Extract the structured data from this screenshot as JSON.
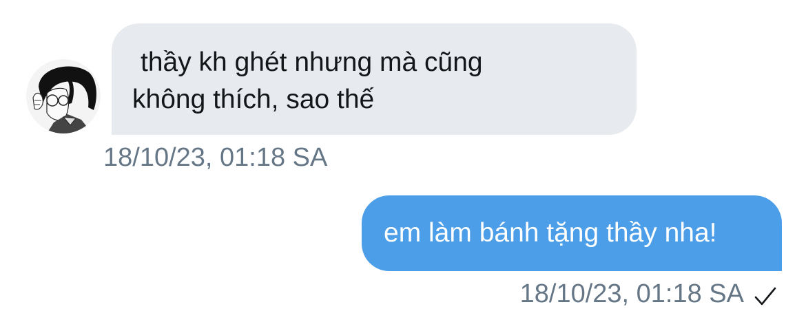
{
  "messages": [
    {
      "direction": "incoming",
      "lines": [
        "thầy kh ghét nhưng mà cũng",
        "không thích, sao thế"
      ],
      "timestamp": "18/10/23, 01:18 SA",
      "avatar_icon": "user-avatar-icon"
    },
    {
      "direction": "outgoing",
      "text": "em làm bánh tặng thầy nha!",
      "timestamp": "18/10/23, 01:18 SA",
      "status_icon": "checkmark-icon"
    }
  ],
  "colors": {
    "incoming_bubble": "#e7eaee",
    "outgoing_bubble": "#4c9ee8",
    "timestamp_text": "#657786",
    "incoming_text": "#14171a",
    "outgoing_text": "#ffffff"
  }
}
